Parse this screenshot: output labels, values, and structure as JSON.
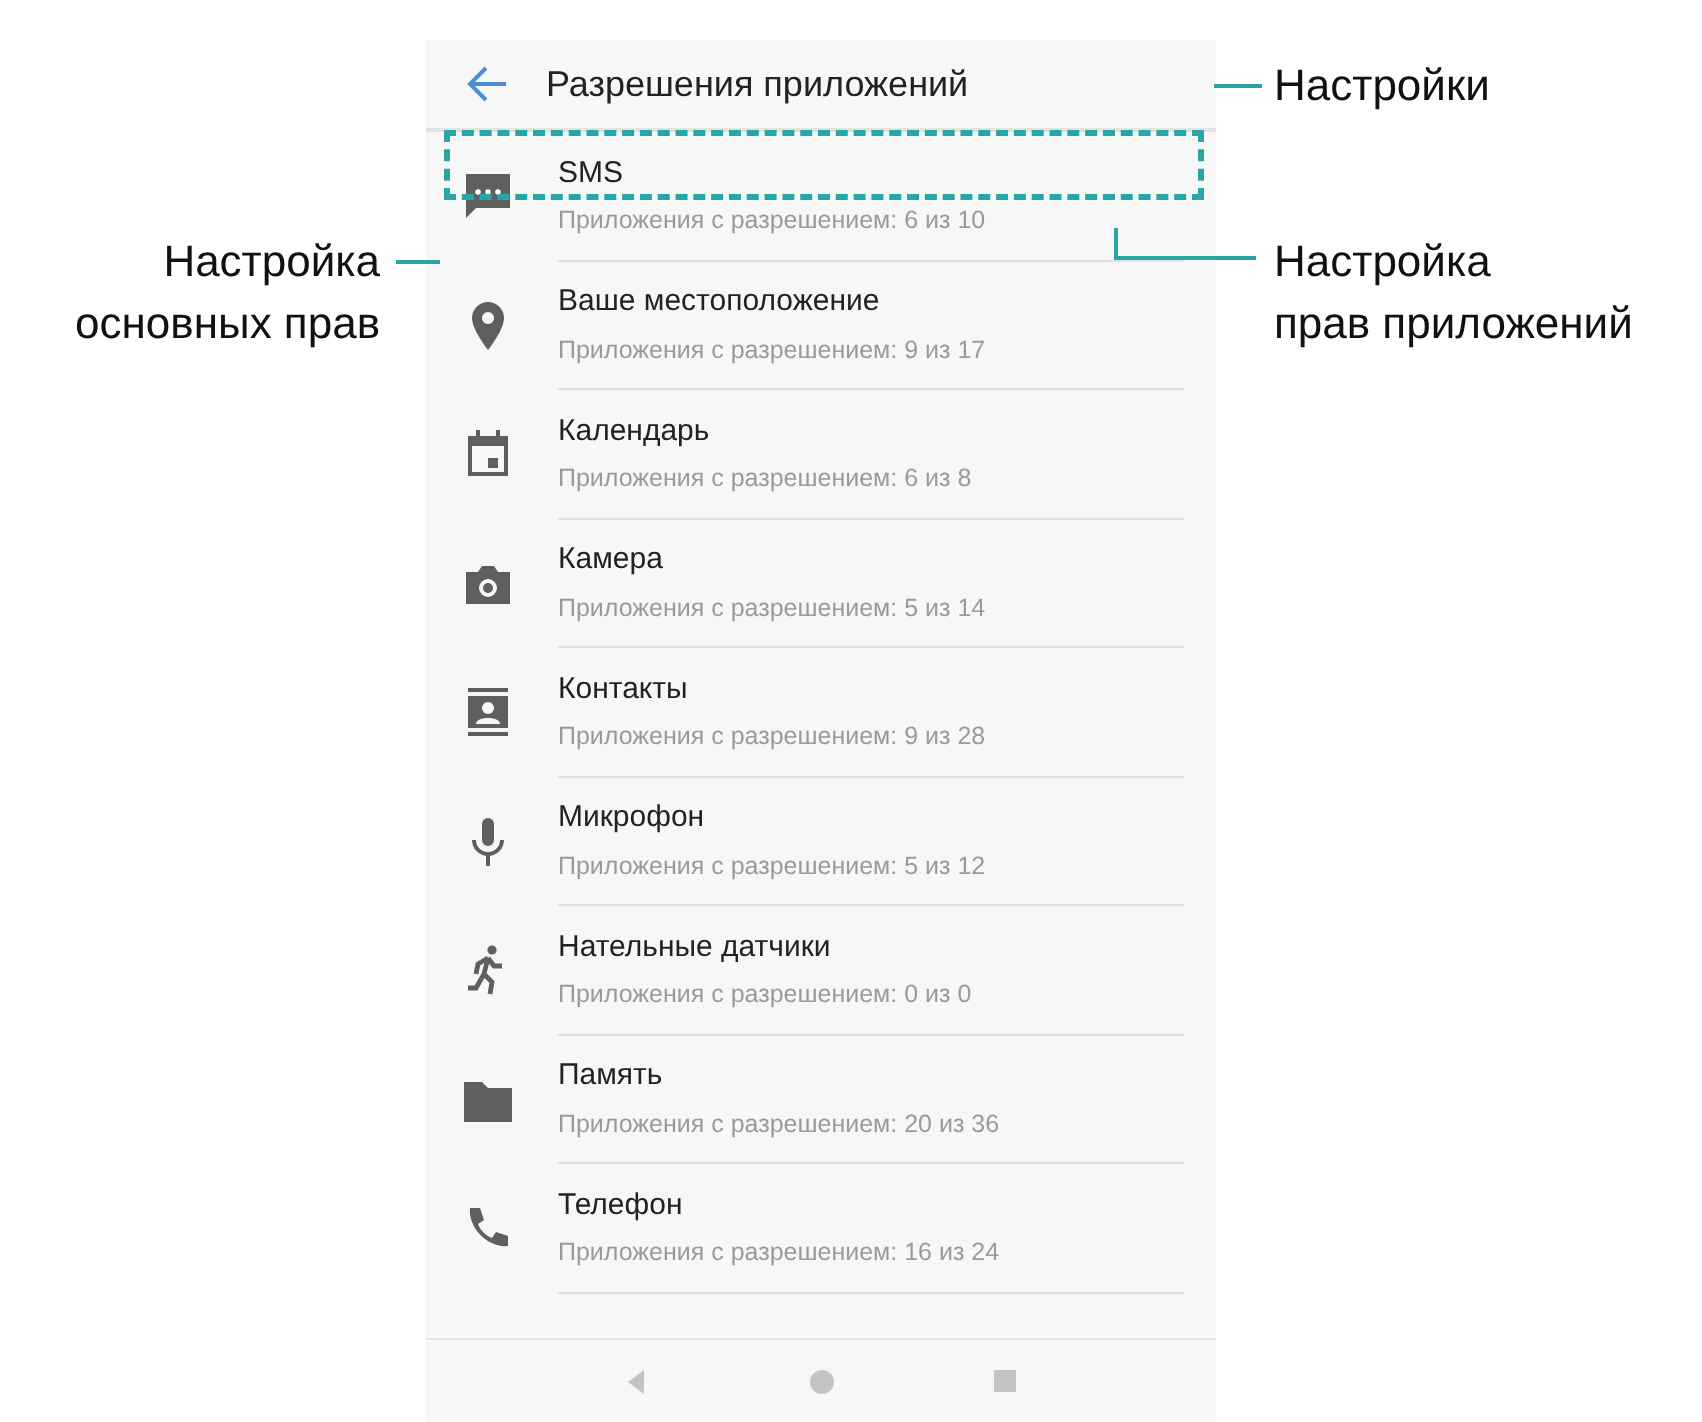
{
  "header": {
    "title": "Разрешения приложений"
  },
  "permissions": [
    {
      "name": "SMS",
      "summary": "Приложения с разрешением: 6 из 10",
      "highlighted": true
    },
    {
      "name": "Ваше местоположение",
      "summary": "Приложения с разрешением: 9 из 17",
      "highlighted": false
    },
    {
      "name": "Календарь",
      "summary": "Приложения с разрешением: 6 из 8",
      "highlighted": false
    },
    {
      "name": "Камера",
      "summary": "Приложения с разрешением: 5 из 14",
      "highlighted": false
    },
    {
      "name": "Контакты",
      "summary": "Приложения с разрешением: 9 из 28",
      "highlighted": false
    },
    {
      "name": "Микрофон",
      "summary": "Приложения с разрешением: 5 из 12",
      "highlighted": false
    },
    {
      "name": "Нательные датчики",
      "summary": "Приложения с разрешением: 0 из 0",
      "highlighted": false
    },
    {
      "name": "Память",
      "summary": "Приложения с разрешением: 20 из 36",
      "highlighted": false
    },
    {
      "name": "Телефон",
      "summary": "Приложения с разрешением: 16 из 24",
      "highlighted": false
    }
  ],
  "callouts": {
    "left": {
      "lines": [
        "Настройка",
        "основных прав"
      ]
    },
    "right_top": {
      "lines": [
        "Настройки"
      ]
    },
    "right_bottom": {
      "lines": [
        "Настройка",
        "прав приложений"
      ]
    }
  }
}
